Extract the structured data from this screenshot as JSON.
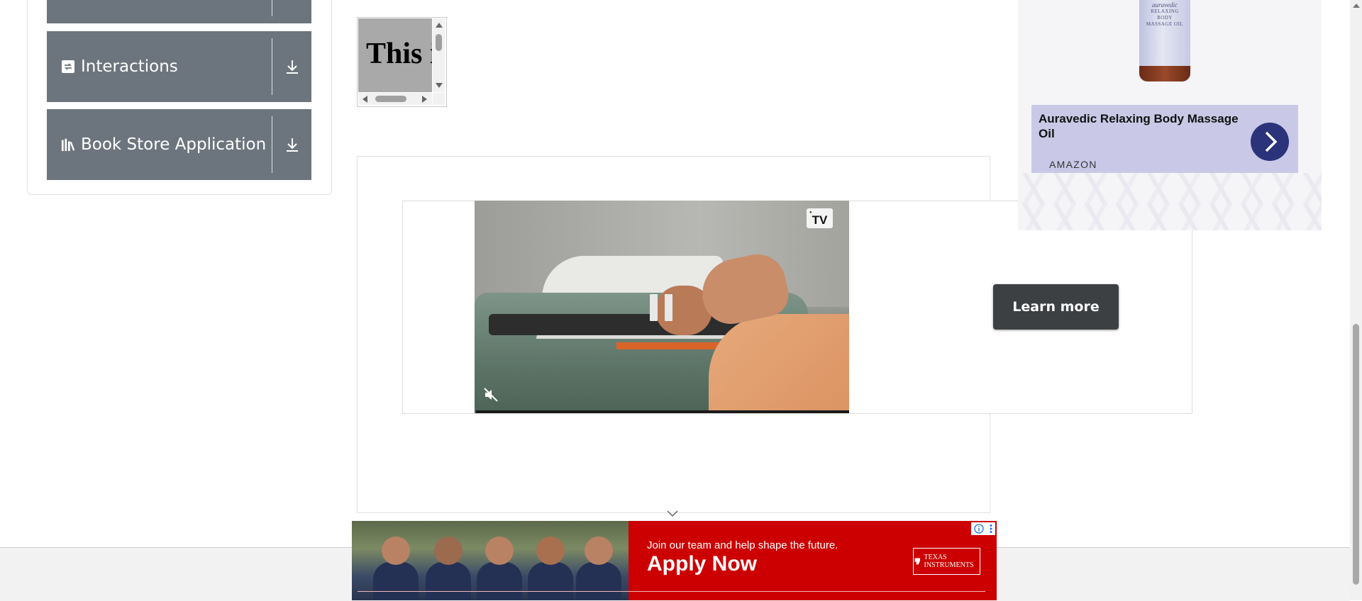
{
  "sidebar": {
    "items": [
      {
        "label": "",
        "icon": "folder-icon"
      },
      {
        "label": "Interactions",
        "icon": "interactions-icon"
      },
      {
        "label": "Book Store Application",
        "icon": "book-store-icon"
      }
    ]
  },
  "scroll_box": {
    "text": "This is a"
  },
  "video_ad": {
    "badge": "TV",
    "cta": "Learn more",
    "state": "paused",
    "muted": true
  },
  "product_ad": {
    "bottle_label": {
      "brand": "auravedic",
      "lines": [
        "RELAXING",
        "BODY",
        "MASSAGE OIL"
      ]
    },
    "title": "Auravedic Relaxing Body Massage Oil",
    "source": "AMAZON",
    "accent": "#2b347a"
  },
  "banner_ad": {
    "tagline": "Join our team and help shape the future.",
    "cta": "Apply Now",
    "logo_text": "TEXAS INSTRUMENTS",
    "background": "#cc0000"
  },
  "colors": {
    "sidebar_item_bg": "#6c757d",
    "cta_bg": "#3c4043"
  }
}
